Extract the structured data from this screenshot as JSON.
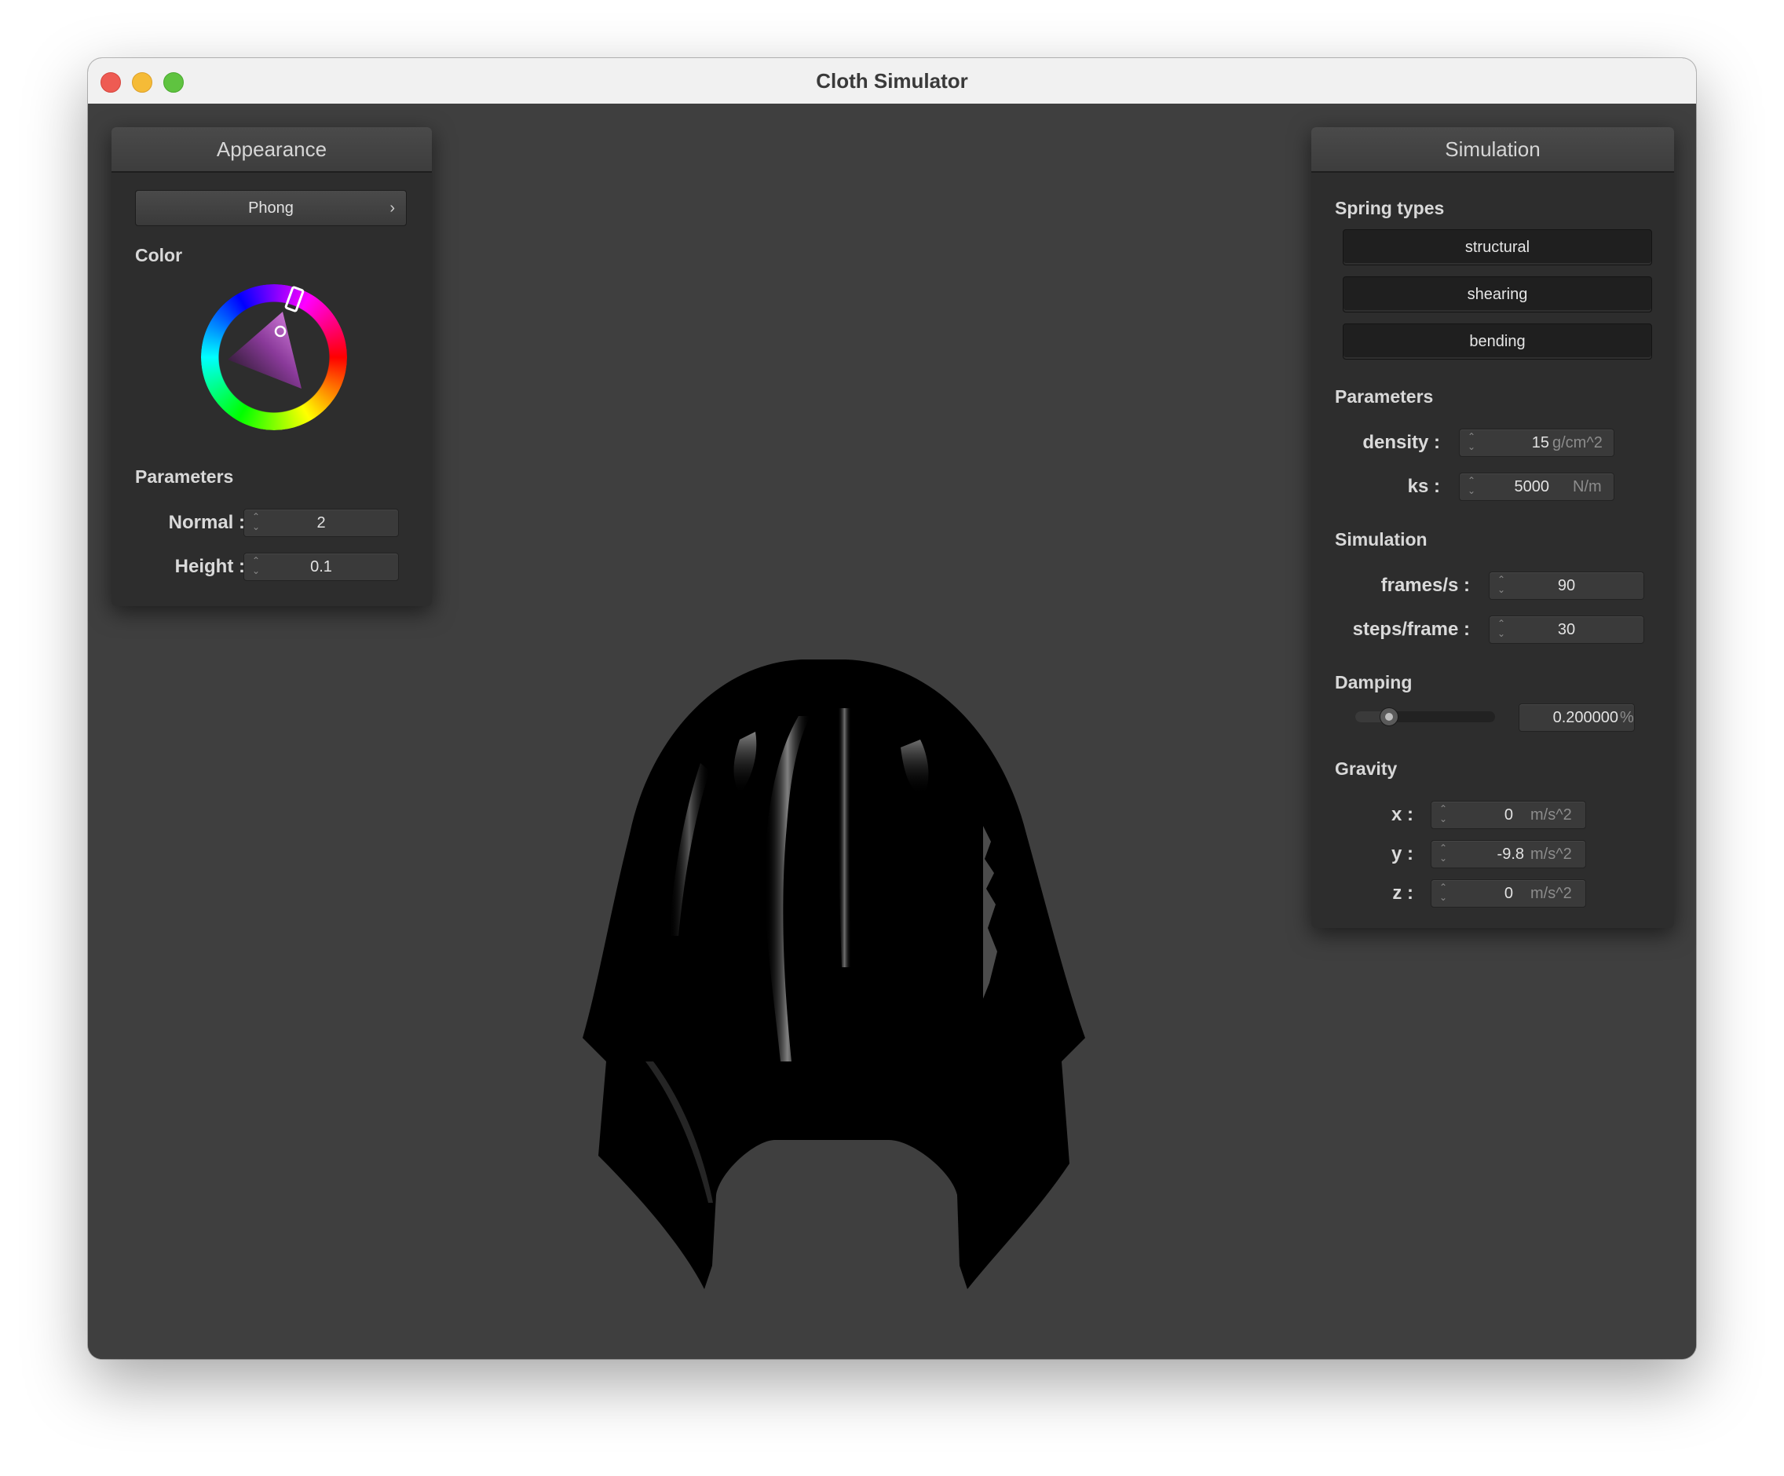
{
  "window": {
    "title": "Cloth Simulator"
  },
  "appearance": {
    "header": "Appearance",
    "shader": "Phong",
    "color_label": "Color",
    "color_hue": 300,
    "parameters_label": "Parameters",
    "normal_label": "Normal :",
    "normal_value": "2",
    "height_label": "Height :",
    "height_value": "0.1"
  },
  "simulation": {
    "header": "Simulation",
    "spring_types_label": "Spring types",
    "spring_buttons": [
      "structural",
      "shearing",
      "bending"
    ],
    "parameters_label": "Parameters",
    "density_label": "density :",
    "density_value": "15",
    "density_unit": "g/cm^2",
    "ks_label": "ks :",
    "ks_value": "5000",
    "ks_unit": "N/m",
    "sim_label": "Simulation",
    "fps_label": "frames/s :",
    "fps_value": "90",
    "steps_label": "steps/frame :",
    "steps_value": "30",
    "damping_label": "Damping",
    "damping_value": "0.200000",
    "damping_unit": "%",
    "damping_slider_fraction": 0.2,
    "gravity_label": "Gravity",
    "gx_label": "x :",
    "gx_value": "0",
    "gy_label": "y :",
    "gy_value": "-9.8",
    "gz_label": "z :",
    "gz_value": "0",
    "gravity_unit": "m/s^2"
  }
}
